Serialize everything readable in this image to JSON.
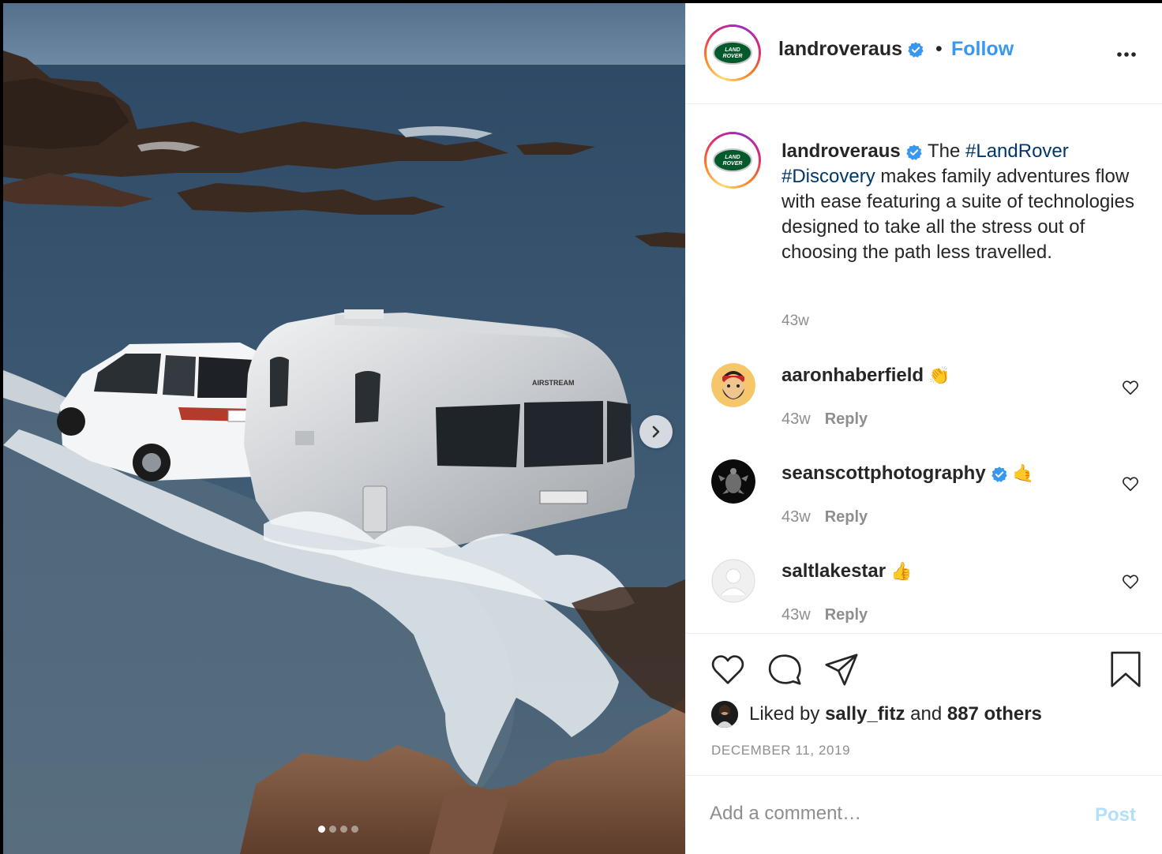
{
  "post": {
    "username": "landroveraus",
    "follow_label": "Follow",
    "separator": "•",
    "logo_text_top": "LAND",
    "logo_text_bottom": "ROVER",
    "brand_color": "#005a2b"
  },
  "media": {
    "trailer_text": "AIRSTREAM",
    "carousel_total": 4,
    "carousel_active": 1
  },
  "caption": {
    "username": "landroveraus",
    "word_the": "The",
    "hashtag_1": "#LandRover",
    "hashtag_2": "#Discovery",
    "body": "makes family adventures flow with ease featuring a suite of technologies designed to take all the stress out of choosing the path less travelled.",
    "time": "43w"
  },
  "comments": [
    {
      "username": "aaronhaberfield",
      "verified": false,
      "emoji": "👏",
      "time": "43w",
      "reply_label": "Reply",
      "avatar_icon": "bearded-man-emoji-avatar"
    },
    {
      "username": "seanscottphotography",
      "verified": true,
      "emoji": "🤙",
      "time": "43w",
      "reply_label": "Reply",
      "avatar_icon": "turtle-photo-avatar"
    },
    {
      "username": "saltlakestar",
      "verified": false,
      "emoji": "👍",
      "time": "43w",
      "reply_label": "Reply",
      "avatar_icon": "default-user-avatar"
    }
  ],
  "likes": {
    "prefix": "Liked by",
    "user": "sally_fitz",
    "conjunction": "and",
    "others": "887 others"
  },
  "date": "DECEMBER 11, 2019",
  "add_comment": {
    "placeholder": "Add a comment…",
    "post_label": "Post"
  },
  "colors": {
    "link_blue": "#3897f0",
    "hashtag_blue": "#00376b",
    "muted": "#8e8e8e",
    "post_disabled": "#b2dffc",
    "verified_blue": "#3897f0"
  }
}
